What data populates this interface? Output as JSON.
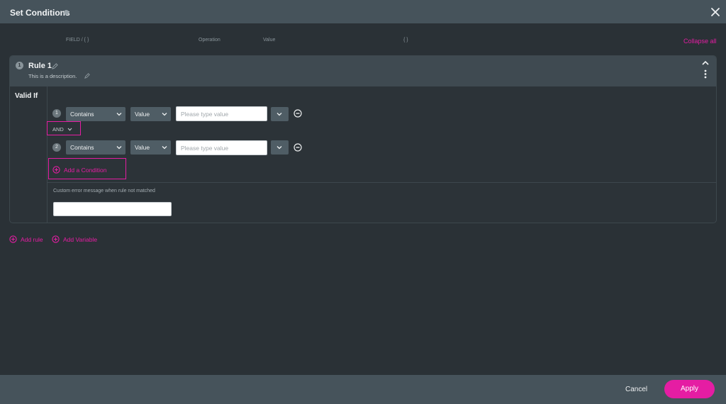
{
  "dialog": {
    "title": "Set Conditions",
    "collapse_all": "Collapse all"
  },
  "rule": {
    "number": "1",
    "name": "Rule 1",
    "description": "This is a description.",
    "valid_if": "Valid If",
    "columns": {
      "field": "FIELD / { }",
      "operation": "Operation",
      "value": "Value",
      "value_braces": "{ }"
    },
    "conditions": [
      {
        "number": "1",
        "operator": "Contains",
        "type": "Value",
        "placeholder": "Please type value"
      },
      {
        "number": "2",
        "operator": "Contains",
        "type": "Value",
        "placeholder": "Please type value"
      }
    ],
    "logic": "AND",
    "add_condition": "Add a Condition",
    "error_message_label": "Custom error message when rule not matched",
    "error_message_value": ""
  },
  "actions": {
    "add_rule": "Add rule",
    "add_variable": "Add Variable"
  },
  "footer": {
    "cancel": "Cancel",
    "apply": "Apply"
  },
  "colors": {
    "accent": "#e51da3",
    "header": "#46535b",
    "background": "#2a3136"
  }
}
